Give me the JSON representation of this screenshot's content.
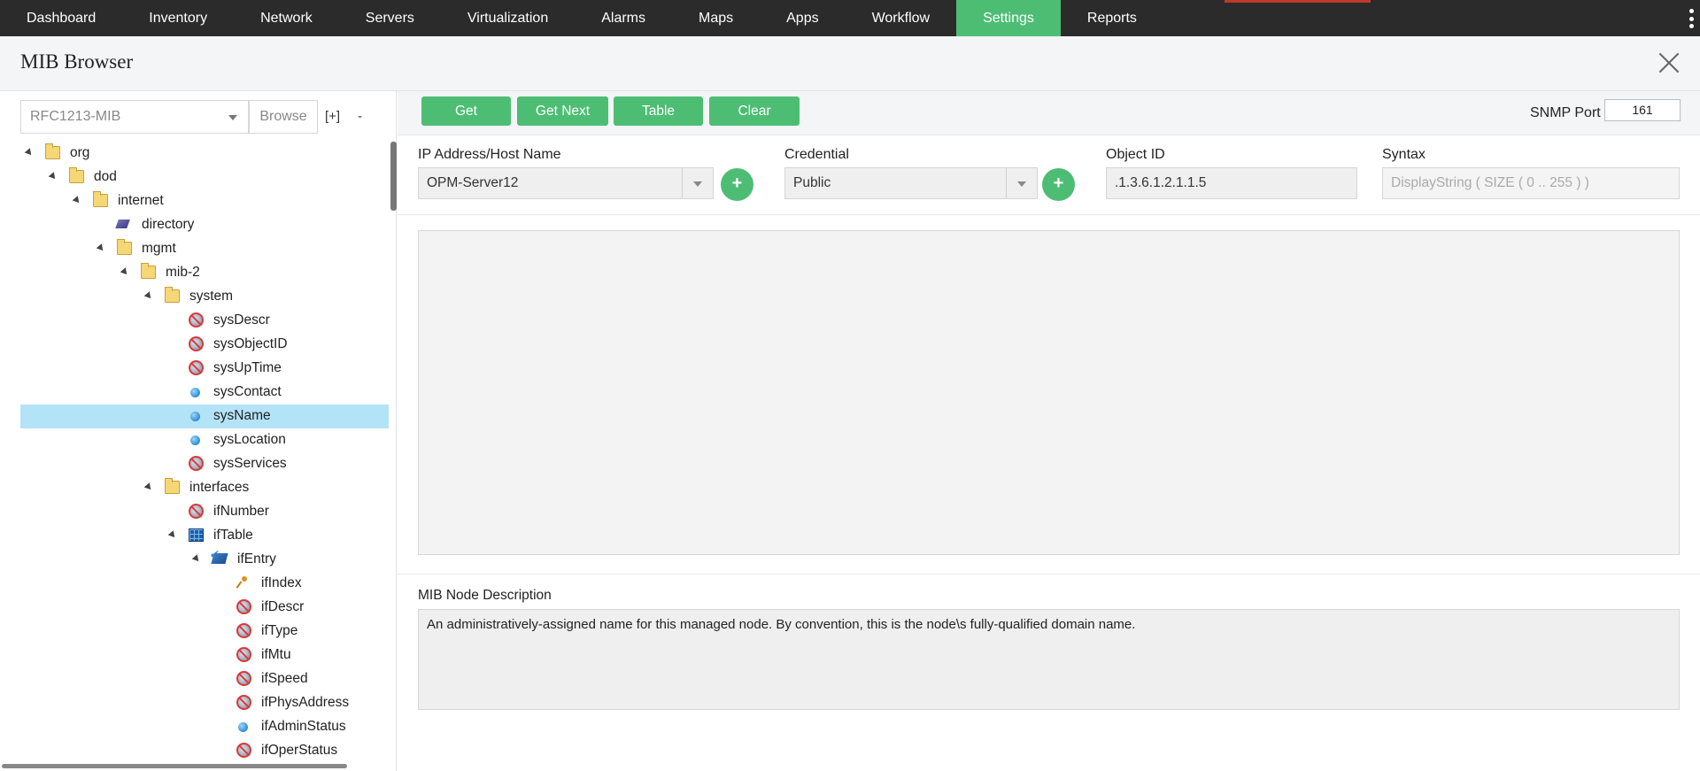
{
  "nav": {
    "items": [
      "Dashboard",
      "Inventory",
      "Network",
      "Servers",
      "Virtualization",
      "Alarms",
      "Maps",
      "Apps",
      "Workflow",
      "Settings",
      "Reports"
    ],
    "active": "Settings",
    "active_color": "#4dbd74"
  },
  "header": {
    "title": "MIB Browser"
  },
  "left": {
    "mib_select_value": "RFC1213-MIB",
    "browse_label": "Browse",
    "expand_label": "[+]",
    "collapse_label": "-",
    "tree": [
      {
        "label": "org",
        "icon": "folder-icon"
      },
      {
        "label": "dod",
        "icon": "folder-icon"
      },
      {
        "label": "internet",
        "icon": "folder-icon"
      },
      {
        "label": "directory",
        "icon": "directory-icon"
      },
      {
        "label": "mgmt",
        "icon": "folder-icon"
      },
      {
        "label": "mib-2",
        "icon": "folder-icon"
      },
      {
        "label": "system",
        "icon": "folder-icon"
      },
      {
        "label": "sysDescr",
        "icon": "read-only-icon"
      },
      {
        "label": "sysObjectID",
        "icon": "read-only-icon"
      },
      {
        "label": "sysUpTime",
        "icon": "read-only-icon"
      },
      {
        "label": "sysContact",
        "icon": "read-write-icon"
      },
      {
        "label": "sysName",
        "icon": "read-write-icon",
        "selected": true
      },
      {
        "label": "sysLocation",
        "icon": "read-write-icon"
      },
      {
        "label": "sysServices",
        "icon": "read-only-icon"
      },
      {
        "label": "interfaces",
        "icon": "folder-icon"
      },
      {
        "label": "ifNumber",
        "icon": "read-only-icon"
      },
      {
        "label": "ifTable",
        "icon": "table-icon"
      },
      {
        "label": "ifEntry",
        "icon": "table-entry-icon"
      },
      {
        "label": "ifIndex",
        "icon": "index-key-icon"
      },
      {
        "label": "ifDescr",
        "icon": "read-only-icon"
      },
      {
        "label": "ifType",
        "icon": "read-only-icon"
      },
      {
        "label": "ifMtu",
        "icon": "read-only-icon"
      },
      {
        "label": "ifSpeed",
        "icon": "read-only-icon"
      },
      {
        "label": "ifPhysAddress",
        "icon": "read-only-icon"
      },
      {
        "label": "ifAdminStatus",
        "icon": "read-write-icon"
      },
      {
        "label": "ifOperStatus",
        "icon": "read-only-icon"
      }
    ]
  },
  "toolbar": {
    "get_label": "Get",
    "get_next_label": "Get Next",
    "table_label": "Table",
    "clear_label": "Clear",
    "snmp_port_label": "SNMP Port",
    "snmp_port_value": "161"
  },
  "form": {
    "ip_label": "IP Address/Host Name",
    "ip_value": "OPM-Server12",
    "credential_label": "Credential",
    "credential_value": "Public",
    "oid_label": "Object ID",
    "oid_value": ".1.3.6.1.2.1.1.5",
    "syntax_label": "Syntax",
    "syntax_value": "DisplayString ( SIZE ( 0 .. 255 ) )",
    "add_symbol": "+"
  },
  "description": {
    "label": "MIB Node Description",
    "text": "An administratively-assigned name for this managed node. By convention, this is the node\\s fully-qualified domain name."
  }
}
